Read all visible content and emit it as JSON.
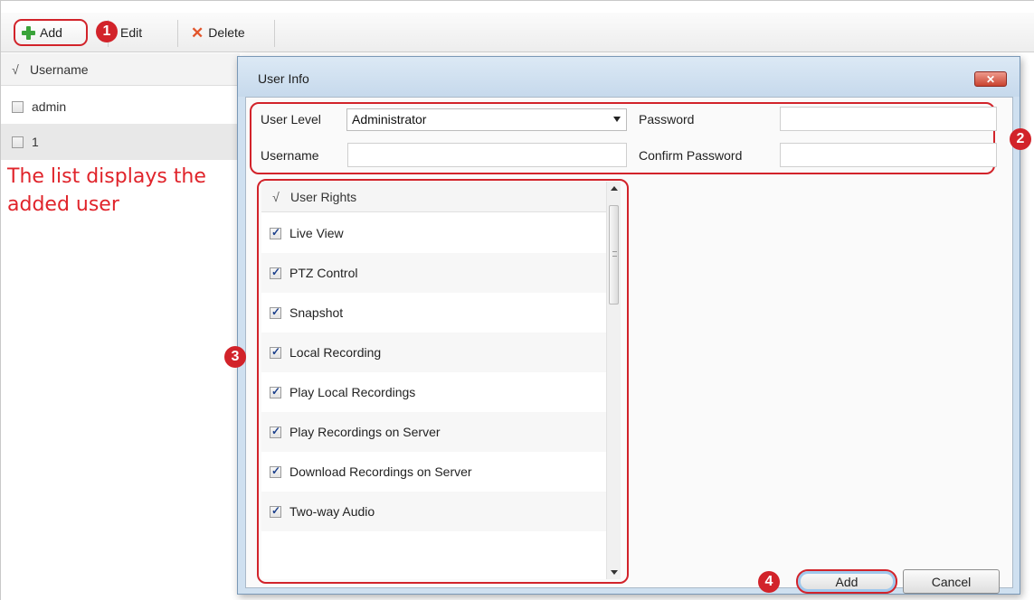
{
  "toolbar": {
    "add_label": "Add",
    "edit_label": "Edit",
    "delete_label": "Delete"
  },
  "user_list": {
    "check_header": "√",
    "column_header": "Username",
    "rows": [
      {
        "username": "admin",
        "checked": false
      },
      {
        "username": "1",
        "checked": false,
        "selected": true
      }
    ]
  },
  "note": "The list displays the added user",
  "callouts": [
    "1",
    "2",
    "3",
    "4"
  ],
  "dialog": {
    "title": "User Info",
    "close_icon": "close-icon",
    "user_level_label": "User Level",
    "user_level_value": "Administrator",
    "password_label": "Password",
    "password_value": "",
    "username_label": "Username",
    "username_value": "",
    "confirm_password_label": "Confirm Password",
    "confirm_password_value": "",
    "rights_check_header": "√",
    "rights_header": "User Rights",
    "rights": [
      {
        "label": "Live View",
        "checked": true
      },
      {
        "label": "PTZ Control",
        "checked": true
      },
      {
        "label": "Snapshot",
        "checked": true
      },
      {
        "label": "Local Recording",
        "checked": true
      },
      {
        "label": "Play Local Recordings",
        "checked": true
      },
      {
        "label": "Play Recordings on Server",
        "checked": true
      },
      {
        "label": "Download Recordings on Server",
        "checked": true
      },
      {
        "label": "Two-way Audio",
        "checked": true
      }
    ],
    "add_button": "Add",
    "cancel_button": "Cancel"
  },
  "colors": {
    "callout_red": "#d2232a",
    "dialog_frame": "#cfe0f0",
    "add_icon_green": "#3aa33a",
    "delete_icon_orange": "#e2552b"
  }
}
